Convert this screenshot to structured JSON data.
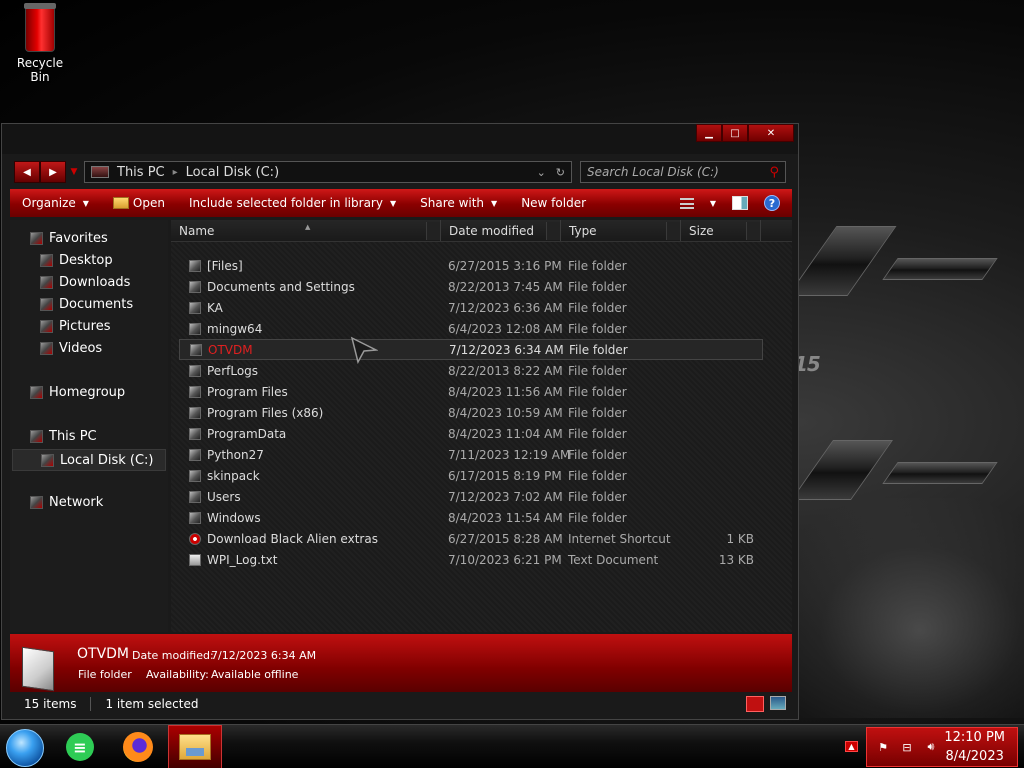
{
  "desktop": {
    "icons": [
      {
        "label": "Recycle Bin",
        "icon": "recycle-bin-icon"
      }
    ],
    "wallpaper_text": "15"
  },
  "window": {
    "controls": {
      "minimize": "▁",
      "maximize": "□",
      "close": "✕"
    },
    "address": {
      "segments": [
        "This PC",
        "Local Disk (C:)"
      ]
    },
    "search_placeholder": "Search Local Disk (C:)",
    "commands": {
      "organize": "Organize",
      "open": "Open",
      "include": "Include selected folder in library",
      "share": "Share with",
      "new_folder": "New folder"
    },
    "nav": {
      "favorites": "Favorites",
      "desktop": "Desktop",
      "downloads": "Downloads",
      "documents": "Documents",
      "pictures": "Pictures",
      "videos": "Videos",
      "homegroup": "Homegroup",
      "this_pc": "This PC",
      "local_disk": "Local Disk (C:)",
      "network": "Network"
    },
    "columns": {
      "name": "Name",
      "date": "Date modified",
      "type": "Type",
      "size": "Size"
    },
    "files": [
      {
        "name": "[Files]",
        "date": "6/27/2015 3:16 PM",
        "type": "File folder",
        "size": ""
      },
      {
        "name": "Documents and Settings",
        "date": "8/22/2013 7:45 AM",
        "type": "File folder",
        "size": ""
      },
      {
        "name": "KA",
        "date": "7/12/2023 6:36 AM",
        "type": "File folder",
        "size": ""
      },
      {
        "name": "mingw64",
        "date": "6/4/2023 12:08 AM",
        "type": "File folder",
        "size": ""
      },
      {
        "name": "OTVDM",
        "date": "7/12/2023 6:34 AM",
        "type": "File folder",
        "size": ""
      },
      {
        "name": "PerfLogs",
        "date": "8/22/2013 8:22 AM",
        "type": "File folder",
        "size": ""
      },
      {
        "name": "Program Files",
        "date": "8/4/2023 11:56 AM",
        "type": "File folder",
        "size": ""
      },
      {
        "name": "Program Files (x86)",
        "date": "8/4/2023 10:59 AM",
        "type": "File folder",
        "size": ""
      },
      {
        "name": "ProgramData",
        "date": "8/4/2023 11:04 AM",
        "type": "File folder",
        "size": ""
      },
      {
        "name": "Python27",
        "date": "7/11/2023 12:19 AM",
        "type": "File folder",
        "size": ""
      },
      {
        "name": "skinpack",
        "date": "6/17/2015 8:19 PM",
        "type": "File folder",
        "size": ""
      },
      {
        "name": "Users",
        "date": "7/12/2023 7:02 AM",
        "type": "File folder",
        "size": ""
      },
      {
        "name": "Windows",
        "date": "8/4/2023 11:54 AM",
        "type": "File folder",
        "size": ""
      },
      {
        "name": "Download Black Alien extras",
        "date": "6/27/2015 8:28 AM",
        "type": "Internet Shortcut",
        "size": "1 KB"
      },
      {
        "name": "WPI_Log.txt",
        "date": "7/10/2023 6:21 PM",
        "type": "Text Document",
        "size": "13 KB"
      }
    ],
    "selected_index": 4,
    "details": {
      "name": "OTVDM",
      "date_label": "Date modified:",
      "date_value": "7/12/2023 6:34 AM",
      "type": "File folder",
      "avail_label": "Availability:",
      "avail_value": "Available offline"
    },
    "status": {
      "items": "15 items",
      "selected": "1 item selected"
    }
  },
  "taskbar": {
    "apps": [
      "start-orb",
      "notes-app-icon",
      "firefox-icon",
      "file-explorer-icon"
    ],
    "clock": {
      "time": "12:10 PM",
      "date": "8/4/2023"
    }
  },
  "colors": {
    "accent": "#c01010",
    "selected_name": "#e02020"
  }
}
